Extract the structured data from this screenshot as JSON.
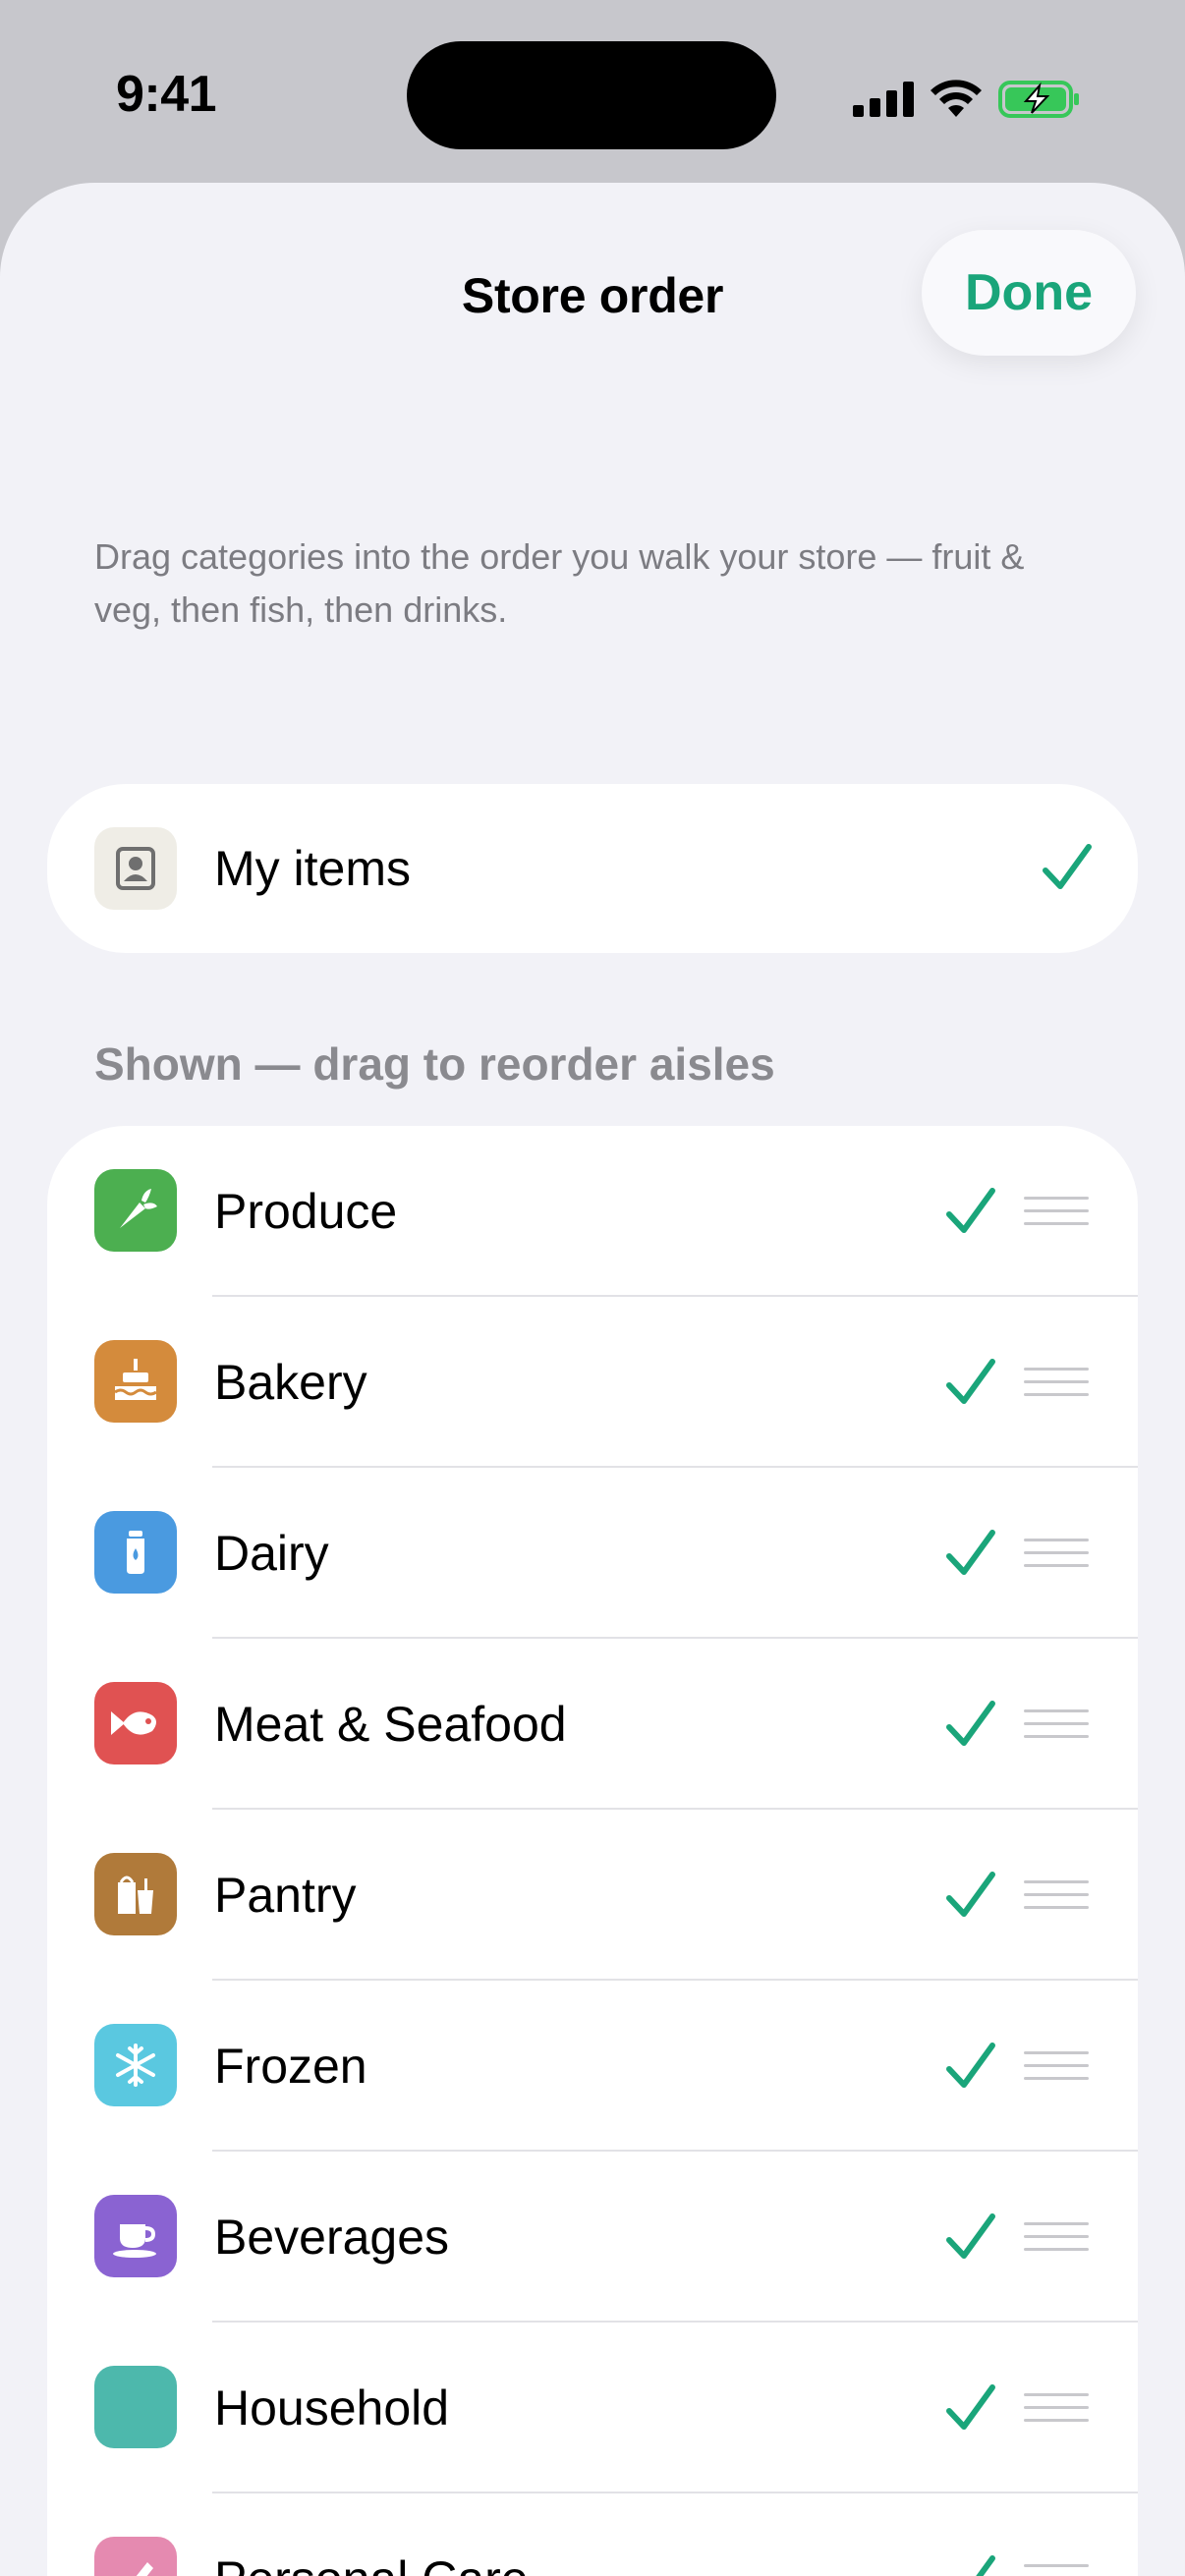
{
  "status": {
    "time": "9:41"
  },
  "header": {
    "title": "Store order",
    "done_label": "Done"
  },
  "instructions": "Drag categories into the order you walk your store — fruit & veg, then fish, then drinks.",
  "my_items": {
    "label": "My items",
    "checked": true,
    "icon": "person-square-icon"
  },
  "shown_section": {
    "header": "Shown — drag to reorder aisles",
    "items": [
      {
        "label": "Produce",
        "icon": "carrot-icon",
        "color": "#4caf50",
        "checked": true
      },
      {
        "label": "Bakery",
        "icon": "cake-icon",
        "color": "#d48b3c",
        "checked": true
      },
      {
        "label": "Dairy",
        "icon": "milk-bottle-icon",
        "color": "#4a9ae0",
        "checked": true
      },
      {
        "label": "Meat & Seafood",
        "icon": "fish-icon",
        "color": "#e05252",
        "checked": true
      },
      {
        "label": "Pantry",
        "icon": "pantry-icon",
        "color": "#b07a3a",
        "checked": true
      },
      {
        "label": "Frozen",
        "icon": "snowflake-icon",
        "color": "#5ac8e0",
        "checked": true
      },
      {
        "label": "Beverages",
        "icon": "cup-icon",
        "color": "#8a63d2",
        "checked": true
      },
      {
        "label": "Household",
        "icon": "household-icon",
        "color": "#4db8ac",
        "checked": true
      },
      {
        "label": "Personal Care",
        "icon": "comb-icon",
        "color": "#e58ab0",
        "checked": true
      }
    ]
  },
  "colors": {
    "accent": "#1aa57a",
    "sheet_bg": "#f2f2f7",
    "secondary_text": "#7c7c82"
  }
}
